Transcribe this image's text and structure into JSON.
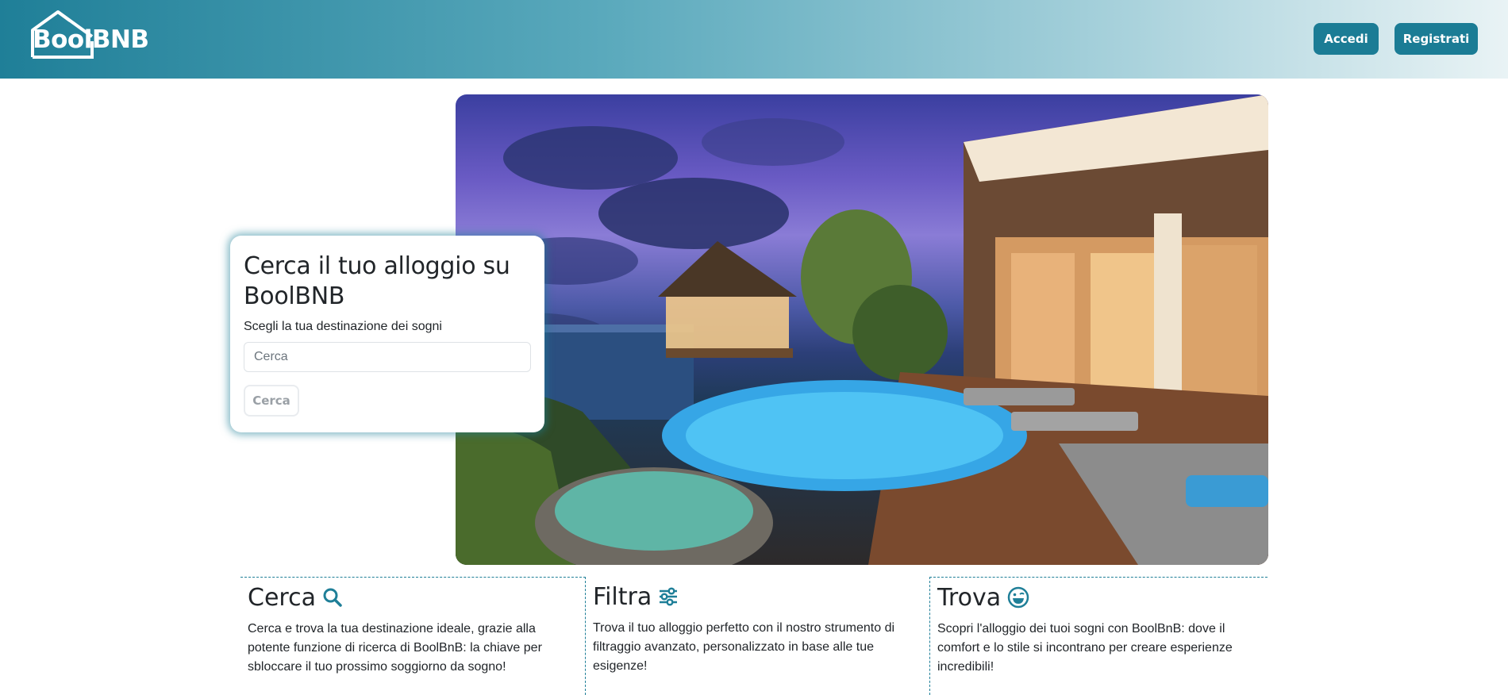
{
  "header": {
    "logo_text": "BoolBNB",
    "login_label": "Accedi",
    "register_label": "Registrati"
  },
  "search": {
    "title": "Cerca il tuo alloggio su BoolBNB",
    "subtitle": "Scegli la tua destinazione dei sogni",
    "placeholder": "Cerca",
    "button_label": "Cerca"
  },
  "features": [
    {
      "title": "Cerca",
      "icon": "search-icon",
      "text": "Cerca e trova la tua destinazione ideale, grazie alla potente funzione di ricerca di BoolBnB: la chiave per sbloccare il tuo prossimo soggiorno da sogno!"
    },
    {
      "title": "Filtra",
      "icon": "sliders-icon",
      "text": "Trova il tuo alloggio perfetto con il nostro strumento di filtraggio avanzato, personalizzato in base alle tue esigenze!"
    },
    {
      "title": "Trova",
      "icon": "smile-icon",
      "text": "Scopri l'alloggio dei tuoi sogni con BoolBnB: dove il comfort e lo stile si incontrano per creare esperienze incredibili!"
    }
  ],
  "colors": {
    "brand": "#1f7f98",
    "button": "#1b7c95"
  }
}
